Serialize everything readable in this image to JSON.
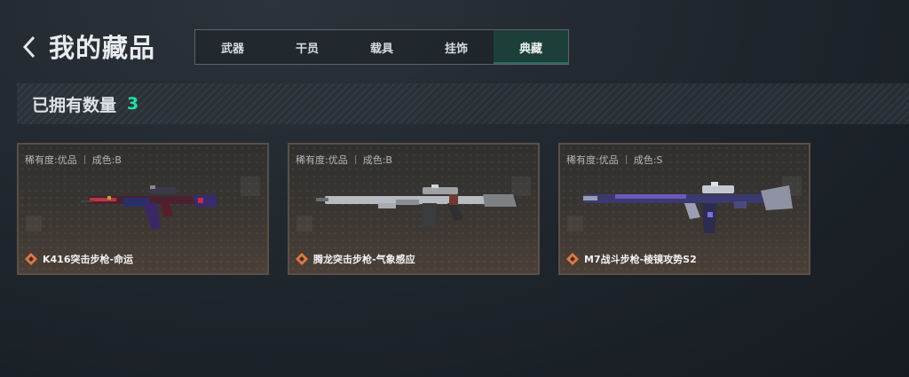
{
  "header": {
    "back_icon": "chevron-left-icon",
    "title": "我的藏品"
  },
  "tabs": [
    {
      "label": "武器",
      "active": false
    },
    {
      "label": "干员",
      "active": false
    },
    {
      "label": "载具",
      "active": false
    },
    {
      "label": "挂饰",
      "active": false
    },
    {
      "label": "典藏",
      "active": true
    }
  ],
  "owned": {
    "label": "已拥有数量",
    "count": "3",
    "count_color": "#20e0a0"
  },
  "items": [
    {
      "rarity": "稀有度:优品",
      "wear": "成色:B",
      "name": "K416突击步枪-命运",
      "icon": "rarity-diamond-icon"
    },
    {
      "rarity": "稀有度:优品",
      "wear": "成色:B",
      "name": "腾龙突击步枪-气象感应",
      "icon": "rarity-diamond-icon"
    },
    {
      "rarity": "稀有度:优品",
      "wear": "成色:S",
      "name": "M7战斗步枪-棱镜攻势S2",
      "icon": "rarity-diamond-icon"
    }
  ],
  "colors": {
    "accent": "#20e0a0",
    "active_tab": "#1d3f39",
    "rarity_icon": "#e07840"
  }
}
